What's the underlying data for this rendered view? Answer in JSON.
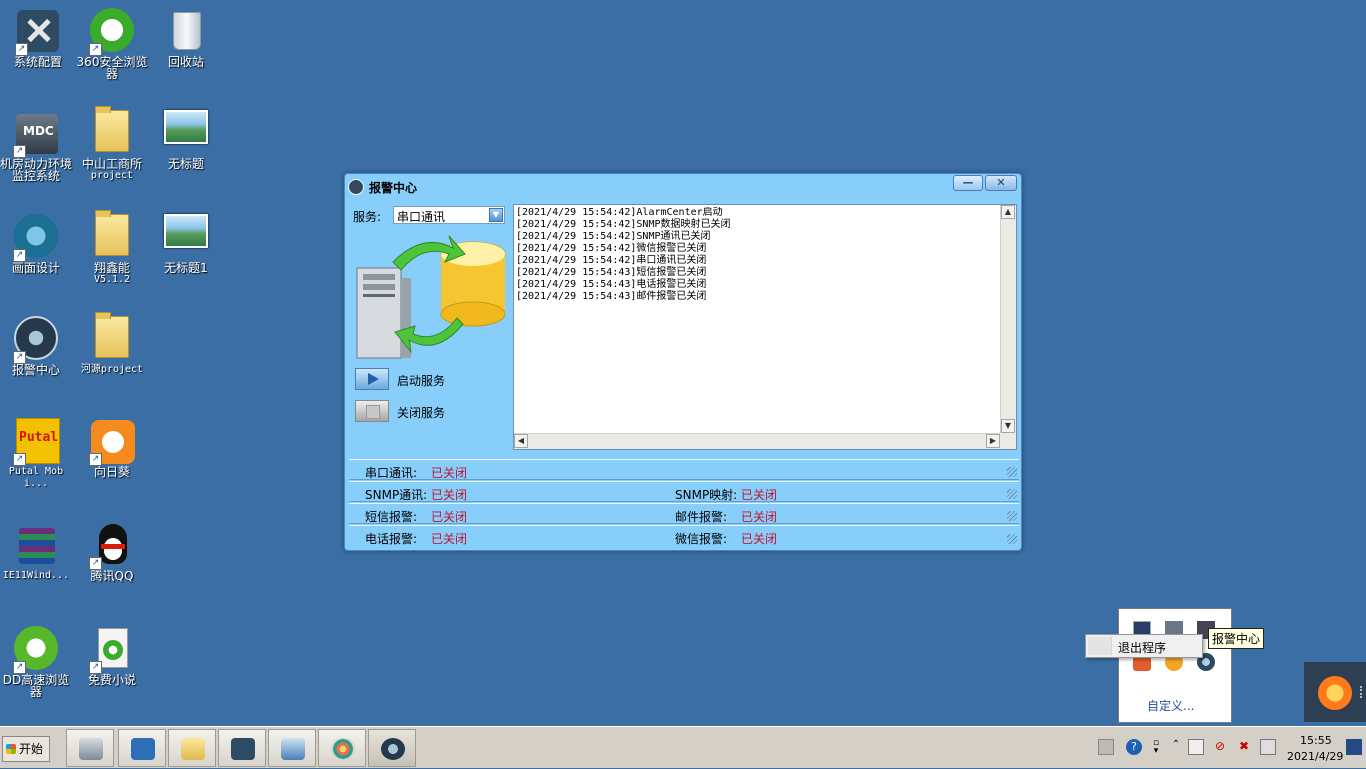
{
  "desktop": {
    "icons": [
      {
        "label": "系统配置"
      },
      {
        "label": "360安全浏览器"
      },
      {
        "label": "回收站"
      },
      {
        "label": "机房动力环境监控系统"
      },
      {
        "label": "中山工商所",
        "sub": "project"
      },
      {
        "label": "无标题"
      },
      {
        "label": "画面设计"
      },
      {
        "label": "翔鑫能",
        "sub": "V5.1.2"
      },
      {
        "label": "无标题1"
      },
      {
        "label": "报警中心"
      },
      {
        "label": "河源project"
      },
      {
        "label": "Putal Mobi..."
      },
      {
        "label": "向日葵"
      },
      {
        "label": "IE11Wind..."
      },
      {
        "label": "腾讯QQ"
      },
      {
        "label": "DD高速浏览器"
      },
      {
        "label": "免费小说"
      }
    ],
    "putal_logo_text": "Putal",
    "mdc_logo_text": "MDC"
  },
  "window": {
    "title": "报警中心",
    "minimize": "—",
    "close": "✕",
    "service_label": "服务:",
    "service_selected": "串口通讯",
    "start_label": "启动服务",
    "stop_label": "关闭服务",
    "log": [
      "[2021/4/29 15:54:42]AlarmCenter启动",
      "[2021/4/29 15:54:42]SNMP数据映射已关闭",
      "[2021/4/29 15:54:42]SNMP通讯已关闭",
      "[2021/4/29 15:54:42]微信报警已关闭",
      "[2021/4/29 15:54:42]串口通讯已关闭",
      "[2021/4/29 15:54:43]短信报警已关闭",
      "[2021/4/29 15:54:43]电话报警已关闭",
      "[2021/4/29 15:54:43]邮件报警已关闭"
    ],
    "status": {
      "serial_label": "串口通讯:",
      "serial_value": "已关闭",
      "snmp_comm_label": "SNMP通讯:",
      "snmp_comm_value": "已关闭",
      "snmp_map_label": "SNMP映射:",
      "snmp_map_value": "已关闭",
      "sms_label": "短信报警:",
      "sms_value": "已关闭",
      "mail_label": "邮件报警:",
      "mail_value": "已关闭",
      "phone_label": "电话报警:",
      "phone_value": "已关闭",
      "wechat_label": "微信报警:",
      "wechat_value": "已关闭"
    },
    "status_color": "#c8102e"
  },
  "taskbar": {
    "start_label": "开始",
    "time": "15:55",
    "date": "2021/4/29",
    "apps": [
      "server-manager-icon",
      "powershell-icon",
      "explorer-icon",
      "system-config-icon",
      "screen-design-icon",
      "paint-icon",
      "alarm-center-icon"
    ]
  },
  "tray_popup": {
    "customize": "自定义...",
    "tooltip": "报警中心",
    "context_item": "退出程序"
  }
}
